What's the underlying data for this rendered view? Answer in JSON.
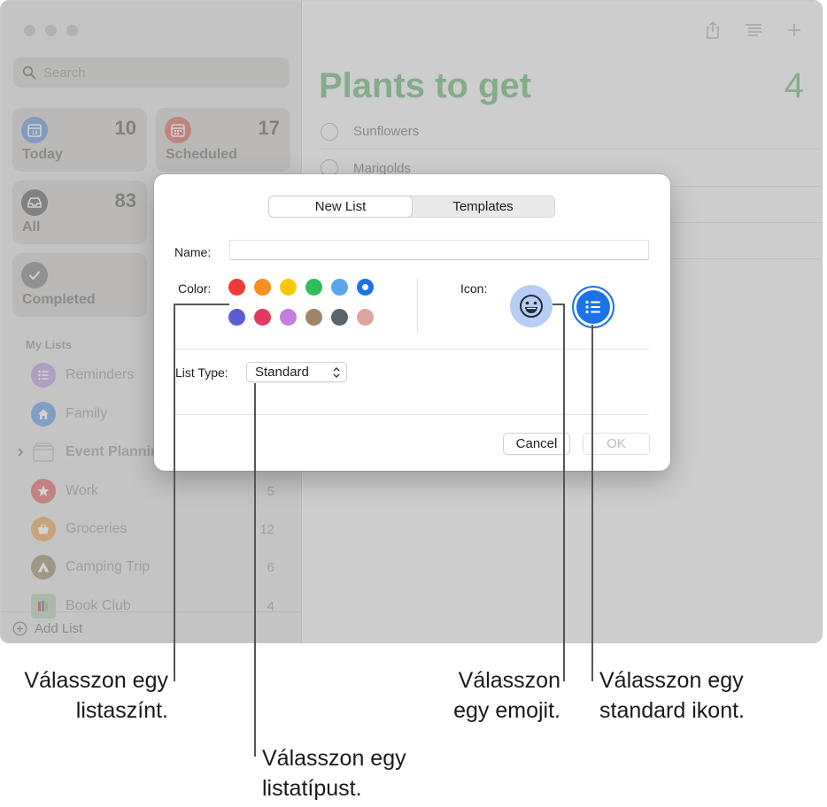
{
  "sidebar": {
    "search_placeholder": "Search",
    "smart_lists": [
      {
        "label": "Today",
        "count": "10",
        "icon": "calendar-today-icon",
        "color": "#3f7fe0",
        "date": "14"
      },
      {
        "label": "Scheduled",
        "count": "17",
        "icon": "calendar-icon",
        "color": "#e85a4f"
      },
      {
        "label": "All",
        "count": "83",
        "icon": "tray-icon",
        "color": "#555555"
      },
      {
        "label": "Completed",
        "count": "",
        "icon": "checkmark-icon",
        "color": "#777777"
      }
    ],
    "my_lists_title": "My Lists",
    "lists": [
      {
        "name": "Reminders",
        "count": "",
        "icon": "list-bullet-icon",
        "color": "#b275e0"
      },
      {
        "name": "Family",
        "count": "",
        "icon": "house-icon",
        "color": "#3d8de6"
      },
      {
        "name": "Event Planning",
        "count": "",
        "icon": "folder-icon",
        "color": "#cfcfcf"
      },
      {
        "name": "Work",
        "count": "5",
        "icon": "star-icon",
        "color": "#e64c4c"
      },
      {
        "name": "Groceries",
        "count": "12",
        "icon": "basket-icon",
        "color": "#ee9b34"
      },
      {
        "name": "Camping Trip",
        "count": "6",
        "icon": "tent-icon",
        "color": "#8d7653"
      },
      {
        "name": "Book Club",
        "count": "4",
        "icon": "books-icon",
        "color": "#6aa36f"
      }
    ],
    "add_list_label": "Add List"
  },
  "main": {
    "title": "Plants to get",
    "count": "4",
    "items": [
      "Sunflowers",
      "Marigolds"
    ]
  },
  "dialog": {
    "tabs": [
      "New List",
      "Templates"
    ],
    "active_tab": "New List",
    "name_label": "Name:",
    "name_value": "",
    "color_label": "Color:",
    "colors": [
      "#ef3b36",
      "#f7901e",
      "#fdc802",
      "#2fbd58",
      "#5aa5ec",
      "#1a73e8",
      "#5e5ad6",
      "#e5385f",
      "#c57ee0",
      "#a2846a",
      "#5b646c",
      "#dba59f"
    ],
    "selected_color": "#1a73e8",
    "icon_label": "Icon:",
    "icons": [
      "emoji-smiley-icon",
      "list-bullet-icon"
    ],
    "list_type_label": "List Type:",
    "list_type_value": "Standard",
    "cancel_label": "Cancel",
    "ok_label": "OK"
  },
  "callouts": {
    "color": [
      "Válasszon egy",
      "listaszínt."
    ],
    "list_type": [
      "Válasszon egy",
      "listatípust."
    ],
    "emoji": [
      "Válasszon",
      "egy emojit."
    ],
    "standard": [
      "Válasszon egy",
      "standard ikont."
    ]
  }
}
